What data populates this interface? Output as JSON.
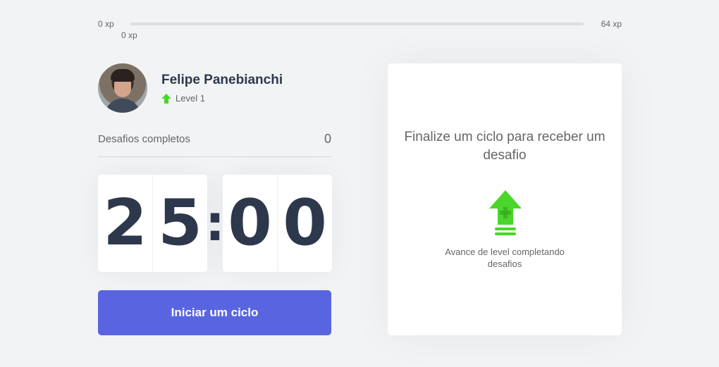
{
  "xp": {
    "start_label": "0 xp",
    "end_label": "64 xp",
    "current_label": "0 xp",
    "progress_fraction": 0
  },
  "profile": {
    "name": "Felipe Panebianchi",
    "level_label": "Level 1"
  },
  "completed": {
    "label": "Desafios completos",
    "count": "0"
  },
  "countdown": {
    "minute_left": "2",
    "minute_right": "5",
    "separator": ":",
    "second_left": "0",
    "second_right": "0"
  },
  "start_button": {
    "label": "Iniciar um ciclo"
  },
  "challenge": {
    "title": "Finalize um ciclo para receber um desafio",
    "description": "Avance de level completando desafios",
    "icon": "level-up-icon"
  },
  "colors": {
    "accent_blue": "#5965e0",
    "accent_green": "#4cd62b",
    "title_dark": "#2e384d",
    "text": "#666666",
    "background": "#f2f3f5"
  }
}
